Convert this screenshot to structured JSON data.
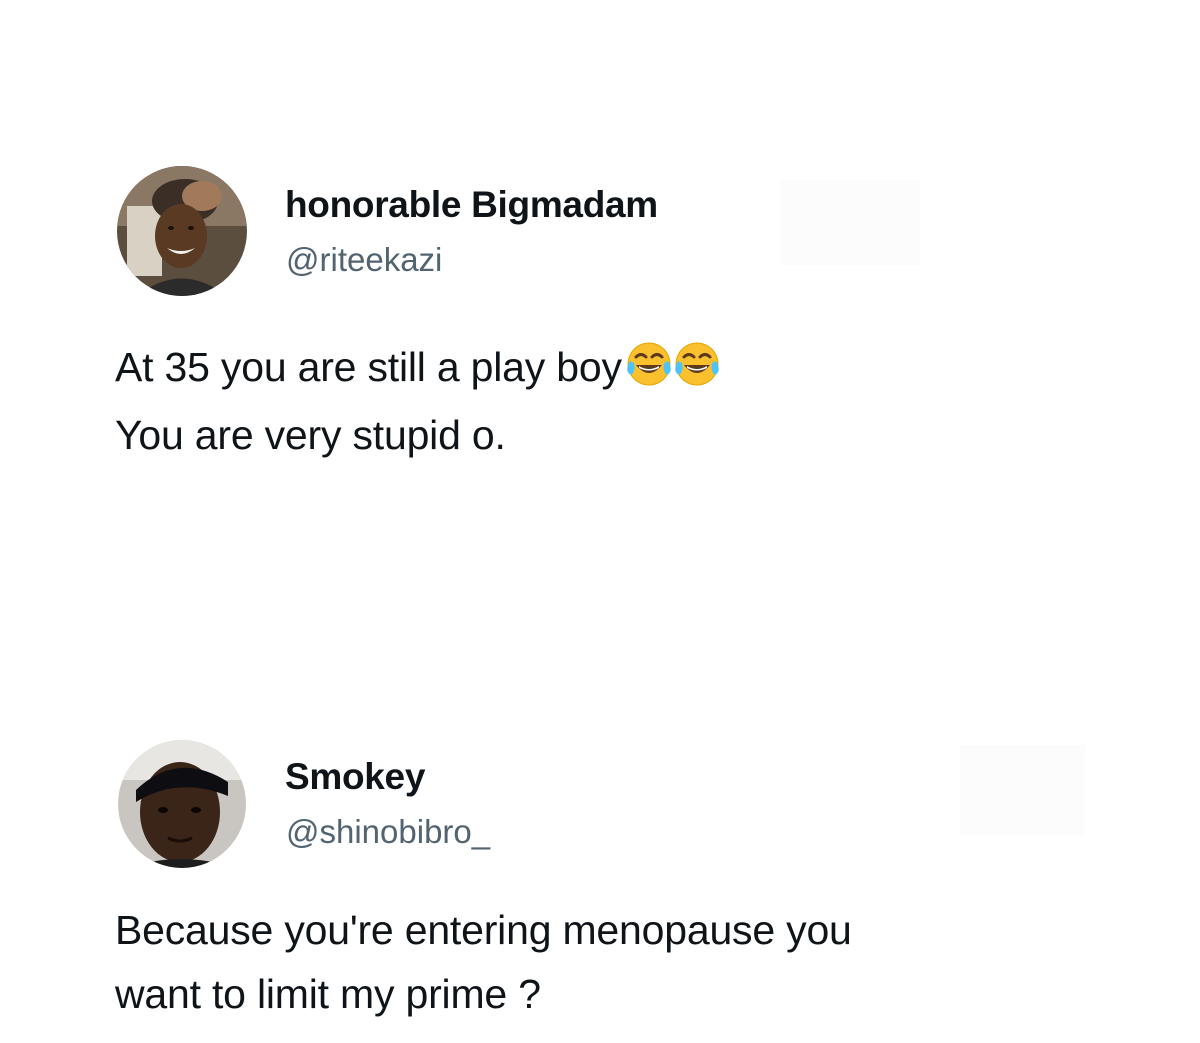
{
  "tweets": [
    {
      "display_name": "honorable Bigmadam",
      "handle": "@riteekazi",
      "text_lines": [
        "At 35 you are still a play boy",
        "You are very stupid o."
      ],
      "emoji": [
        "face-with-tears-of-joy",
        "face-with-tears-of-joy"
      ]
    },
    {
      "display_name": "Smokey",
      "handle": "@shinobibro_",
      "text_lines": [
        "Because you're entering menopause you",
        "want to limit my prime ?"
      ]
    }
  ],
  "colors": {
    "text_primary": "#0f1419",
    "text_secondary": "#536471",
    "background": "#ffffff",
    "emoji_face": "#fbc02d"
  }
}
